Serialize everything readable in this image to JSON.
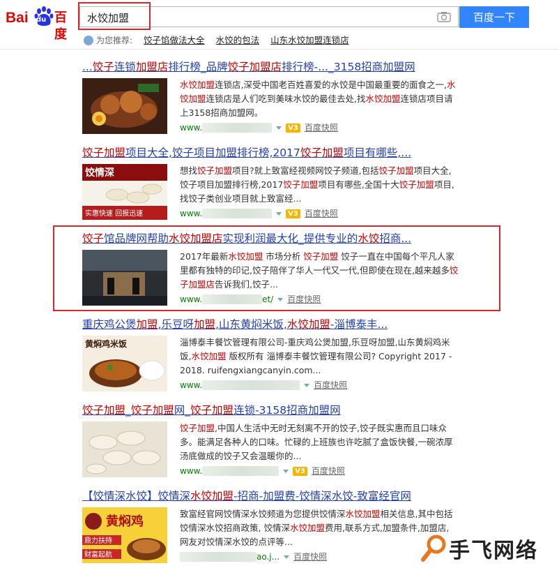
{
  "logo": {
    "part1": "Bai",
    "part2": "du",
    "part3": "百度"
  },
  "search": {
    "query": "水饺加盟",
    "button_label": "百度一下"
  },
  "recommend": {
    "label": "为您推荐:",
    "items": [
      "饺子馅做法大全",
      "水饺的包法",
      "山东水饺加盟连锁店"
    ]
  },
  "results": [
    {
      "title_html": "...<em>饺子</em>连锁<em>加盟店</em>排行榜_品牌<em>饺子加盟店</em>排行榜-..._3158招商加盟网",
      "desc_html": "<em>水饺加盟</em>连锁店,深受中国老百姓喜爱的水饺是中国最重要的面食之一,<em>水饺加盟</em>连锁店是人们吃到美味水饺的最佳去处,找<em>水饺加盟</em>连锁店项目请上3158招商加盟网。",
      "url_prefix": "www.",
      "url_suffix": "",
      "badge": "V3",
      "snapshot": "百度快照"
    },
    {
      "title_html": "<em>饺子加盟</em>项目大全,饺子项目加盟排行榜,2017<em>饺子加盟</em>项目有哪些,...",
      "desc_html": "想找<em>饺子加盟</em>项目?就上致富经视频网饺子频道,包括<em>饺子加盟</em>项目大全,饺子项目加盟排行榜,2017<em>饺子加盟</em>项目有哪些,全国十大<em>饺子加盟</em>项目,找饺子类创业项目就上致富经...",
      "url_prefix": "www.",
      "url_suffix": "",
      "badge": "V3",
      "snapshot": "百度快照"
    },
    {
      "title_html": "<em>饺子</em>馆品牌网帮助<em>水饺加盟店</em>实现利润最大化_提供专业的<em>水饺</em>招商...",
      "desc_html": "2017年最新<em>水饺加盟</em> 市场分析 <em>饺子加盟</em> 饺子一直在中国每个平凡人家里都有独特的印记,饺子陪伴了华人一代又一代,但即使在现在,越来越多<em>饺子加盟店</em>告诉我们,饺子...",
      "url_prefix": "www.",
      "url_suffix": "et/",
      "badge": "",
      "snapshot": "百度快照"
    },
    {
      "title_html": "重庆鸡公煲<em>加盟</em>,乐豆呀<em>加盟</em>,山东黄焖米饭,<em>水饺加盟</em>-淄博泰丰...",
      "desc_html": "淄博泰丰餐饮管理有限公司-重庆鸡公煲加盟,乐豆呀加盟,山东黄焖鸡米饭,<em>水饺加盟</em> 版权所有 淄博泰丰餐饮管理有限公司? Copyright 2017 - 2018. ruifengxiangcanyin.com...",
      "url_prefix": "www.",
      "url_suffix": "",
      "badge": "",
      "snapshot": "百度快照"
    },
    {
      "title_html": "<em>饺子加盟</em>_<em>饺子加盟</em>网_<em>饺子加盟</em>连锁-3158招商加盟网",
      "desc_html": "<em>饺子加盟</em>,中国人生活中无时无刻离不开的饺子,饺子既实惠而且口味众多。能满足各种人的口味。忙碌的上班族也许吃腻了盒饭快餐,一碗浓厚汤底做成的饺子又会温暖你的...",
      "url_prefix": "www.",
      "url_suffix": "",
      "badge": "V3",
      "snapshot": "百度快照"
    },
    {
      "title_html": "【饺情深水饺】饺情深<em>水饺加盟</em>-招商-加盟费-饺情深水饺-致富经官网",
      "desc_html": "致富经官网饺情深水饺频道为您提供饺情深<em>水饺加盟</em>相关信息,其中包括饺情深水饺招商政策, 饺情深<em>水饺加盟</em>费用,联系方式,加盟条件,加盟店, 网友对饺情深水饺的点评等...",
      "url_prefix": "",
      "url_suffix": "ao.j...",
      "badge": "",
      "snapshot": "百度快照"
    }
  ],
  "thumbs": {
    "t2": {
      "line1": "饺情深",
      "line2": "实惠快速 回报迅速"
    },
    "t4": {
      "line1": "黄焖鸡米饭"
    },
    "t6": {
      "line1": "黄焖鸡",
      "line2": "鼎力扶持",
      "line3": "财富起航"
    }
  },
  "watermark": {
    "text": "手飞网络"
  },
  "colors": {
    "accent": "#3385ff",
    "highlight": "#cc0000",
    "link": "#2440b3",
    "url": "#008000",
    "annotation": "#d9262c"
  }
}
